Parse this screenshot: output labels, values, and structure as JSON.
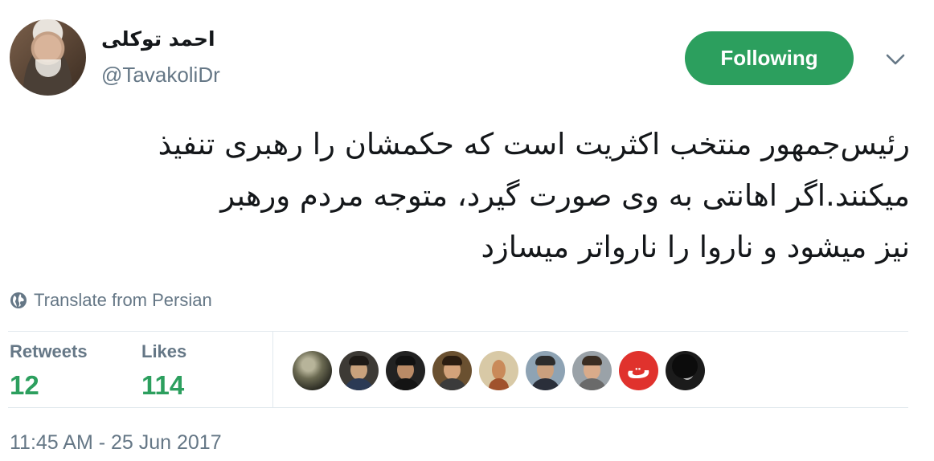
{
  "author": {
    "display_name": "احمد توکلی",
    "handle": "@TavakoliDr",
    "avatar_icon": "user-avatar"
  },
  "follow_button": {
    "label": "Following",
    "color": "#2c9f5e"
  },
  "menu": {
    "icon": "chevron-down-icon"
  },
  "tweet": {
    "lines": [
      "رئیس‌جمهور منتخب اکثریت است که حکمشان را رهبری تنفیذ",
      "میکنند.اگر اهانتی به وی صورت گیرد، متوجه مردم ورهبر",
      "نیز میشود و ناروا را نارواتر میسازد"
    ]
  },
  "translate": {
    "icon": "globe-icon",
    "label": "Translate from Persian"
  },
  "stats": {
    "retweets_label": "Retweets",
    "retweets_value": "12",
    "likes_label": "Likes",
    "likes_value": "114"
  },
  "likers": [
    {
      "name": "liker-avatar-1",
      "style": "sphere"
    },
    {
      "name": "liker-avatar-2",
      "style": "person"
    },
    {
      "name": "liker-avatar-3",
      "style": "person"
    },
    {
      "name": "liker-avatar-4",
      "style": "person"
    },
    {
      "name": "liker-avatar-5",
      "style": "figure"
    },
    {
      "name": "liker-avatar-6",
      "style": "person"
    },
    {
      "name": "liker-avatar-7",
      "style": "person"
    },
    {
      "name": "liker-avatar-8",
      "style": "logo",
      "glyph": "ت"
    },
    {
      "name": "liker-avatar-9",
      "style": "person-dark"
    }
  ],
  "timestamp": "11:45 AM - 25 Jun 2017"
}
